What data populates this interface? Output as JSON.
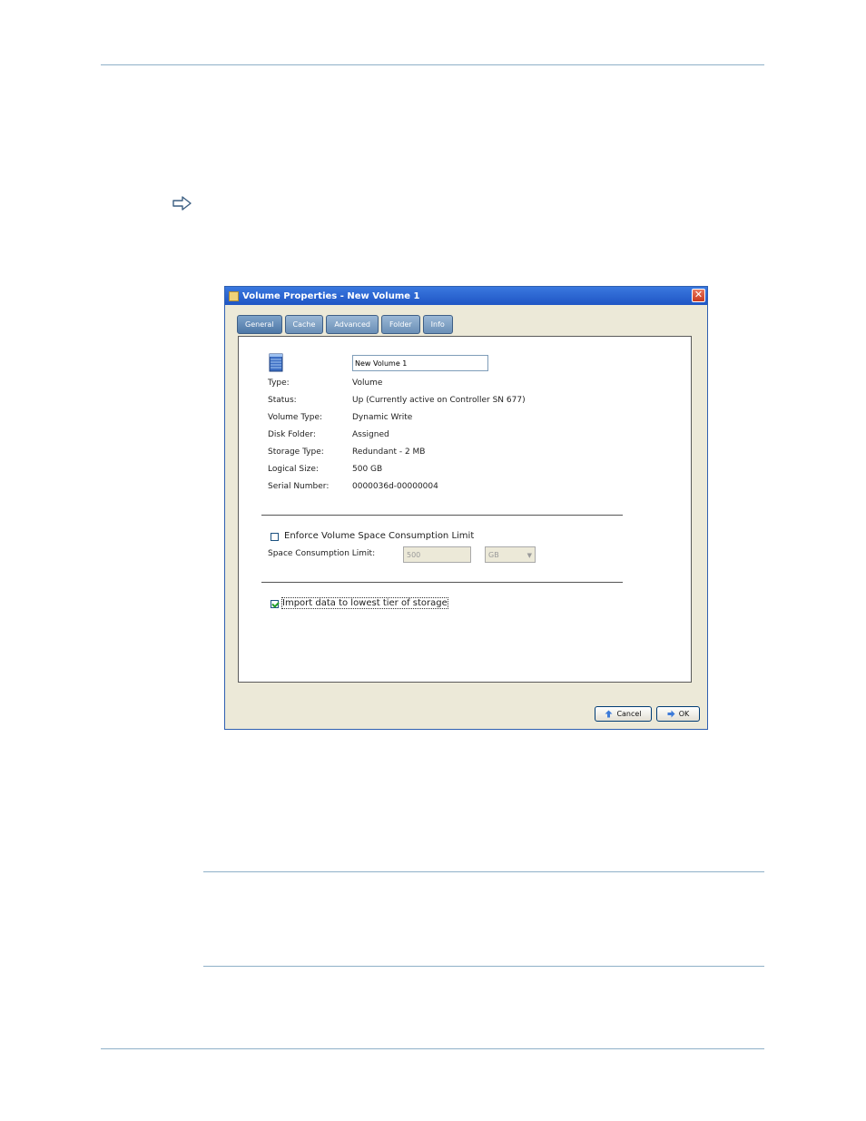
{
  "dialog": {
    "title": "Volume Properties - New Volume 1",
    "close_symbol": "✕",
    "tabs": [
      {
        "label": "General",
        "active": true
      },
      {
        "label": "Cache",
        "active": false
      },
      {
        "label": "Advanced",
        "active": false
      },
      {
        "label": "Folder",
        "active": false
      },
      {
        "label": "Info",
        "active": false
      }
    ],
    "name_value": "New Volume 1",
    "properties": [
      {
        "label": "Type:",
        "value": "Volume"
      },
      {
        "label": "Status:",
        "value": "Up  (Currently active on Controller SN 677)"
      },
      {
        "label": "Volume Type:",
        "value": "Dynamic Write"
      },
      {
        "label": "Disk Folder:",
        "value": "Assigned"
      },
      {
        "label": "Storage Type:",
        "value": "Redundant - 2 MB"
      },
      {
        "label": "Logical Size:",
        "value": "500 GB"
      },
      {
        "label": "Serial Number:",
        "value": "0000036d-00000004"
      }
    ],
    "enforce_limit": {
      "label": "Enforce Volume Space Consumption Limit",
      "checked": false
    },
    "space_limit": {
      "label": "Space Consumption Limit:",
      "value": "500",
      "unit": "GB"
    },
    "import_data": {
      "label": "Import data to lowest tier of storage",
      "checked": true
    },
    "buttons": {
      "cancel": "Cancel",
      "ok": "OK"
    }
  },
  "colors": {
    "title_bar": "#1f55c4",
    "tab": "#6a8fb6",
    "rule": "#8fb0c8"
  }
}
